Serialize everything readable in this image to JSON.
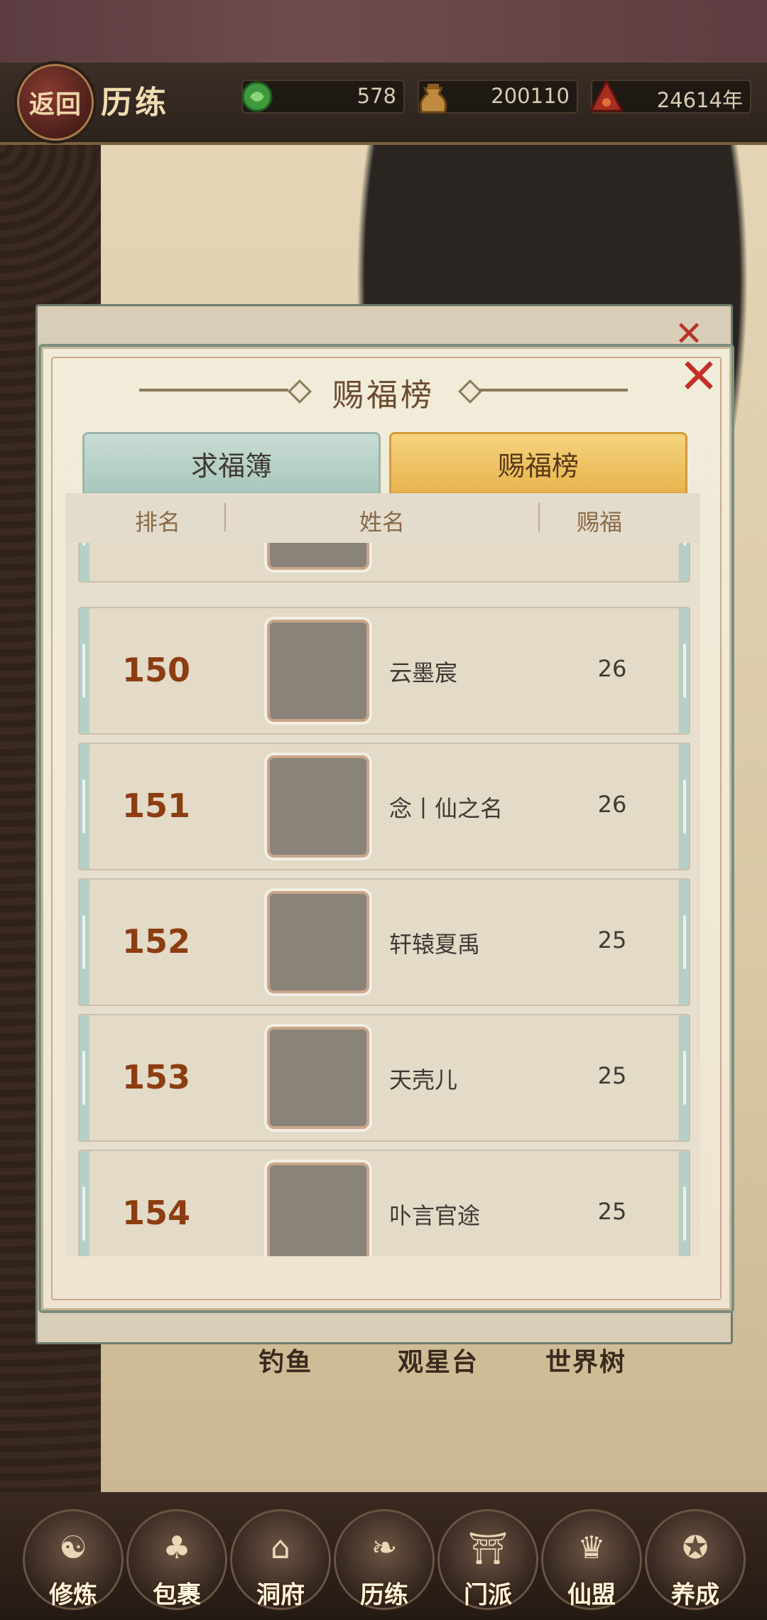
{
  "header": {
    "back_label": "返回",
    "title": "历练",
    "resources": [
      {
        "icon": "jade-coin-icon",
        "value": "578"
      },
      {
        "icon": "money-bag-icon",
        "value": "200110"
      },
      {
        "icon": "lifespan-icon",
        "value": "24614年"
      }
    ]
  },
  "background": {
    "labels": [
      "钓鱼",
      "观星台",
      "世界树"
    ]
  },
  "dialog": {
    "title": "赐福榜",
    "tabs": [
      {
        "label": "求福簿",
        "active": false
      },
      {
        "label": "赐福榜",
        "active": true
      }
    ],
    "columns": [
      "排名",
      "姓名",
      "赐福"
    ],
    "rows": [
      {
        "rank": "150",
        "name": "云墨宸",
        "value": "26"
      },
      {
        "rank": "151",
        "name": "念丨仙之名",
        "value": "26"
      },
      {
        "rank": "152",
        "name": "轩辕夏禹",
        "value": "25"
      },
      {
        "rank": "153",
        "name": "天壳儿",
        "value": "25"
      },
      {
        "rank": "154",
        "name": "卟言官途",
        "value": "25"
      }
    ]
  },
  "nav": {
    "items": [
      {
        "label": "修炼",
        "icon": "cultivator-icon"
      },
      {
        "label": "包裹",
        "icon": "bag-icon"
      },
      {
        "label": "洞府",
        "icon": "cave-palace-icon"
      },
      {
        "label": "历练",
        "icon": "scroll-icon"
      },
      {
        "label": "门派",
        "icon": "sect-gate-icon"
      },
      {
        "label": "仙盟",
        "icon": "alliance-banner-icon"
      },
      {
        "label": "养成",
        "icon": "pentagram-icon"
      }
    ]
  }
}
